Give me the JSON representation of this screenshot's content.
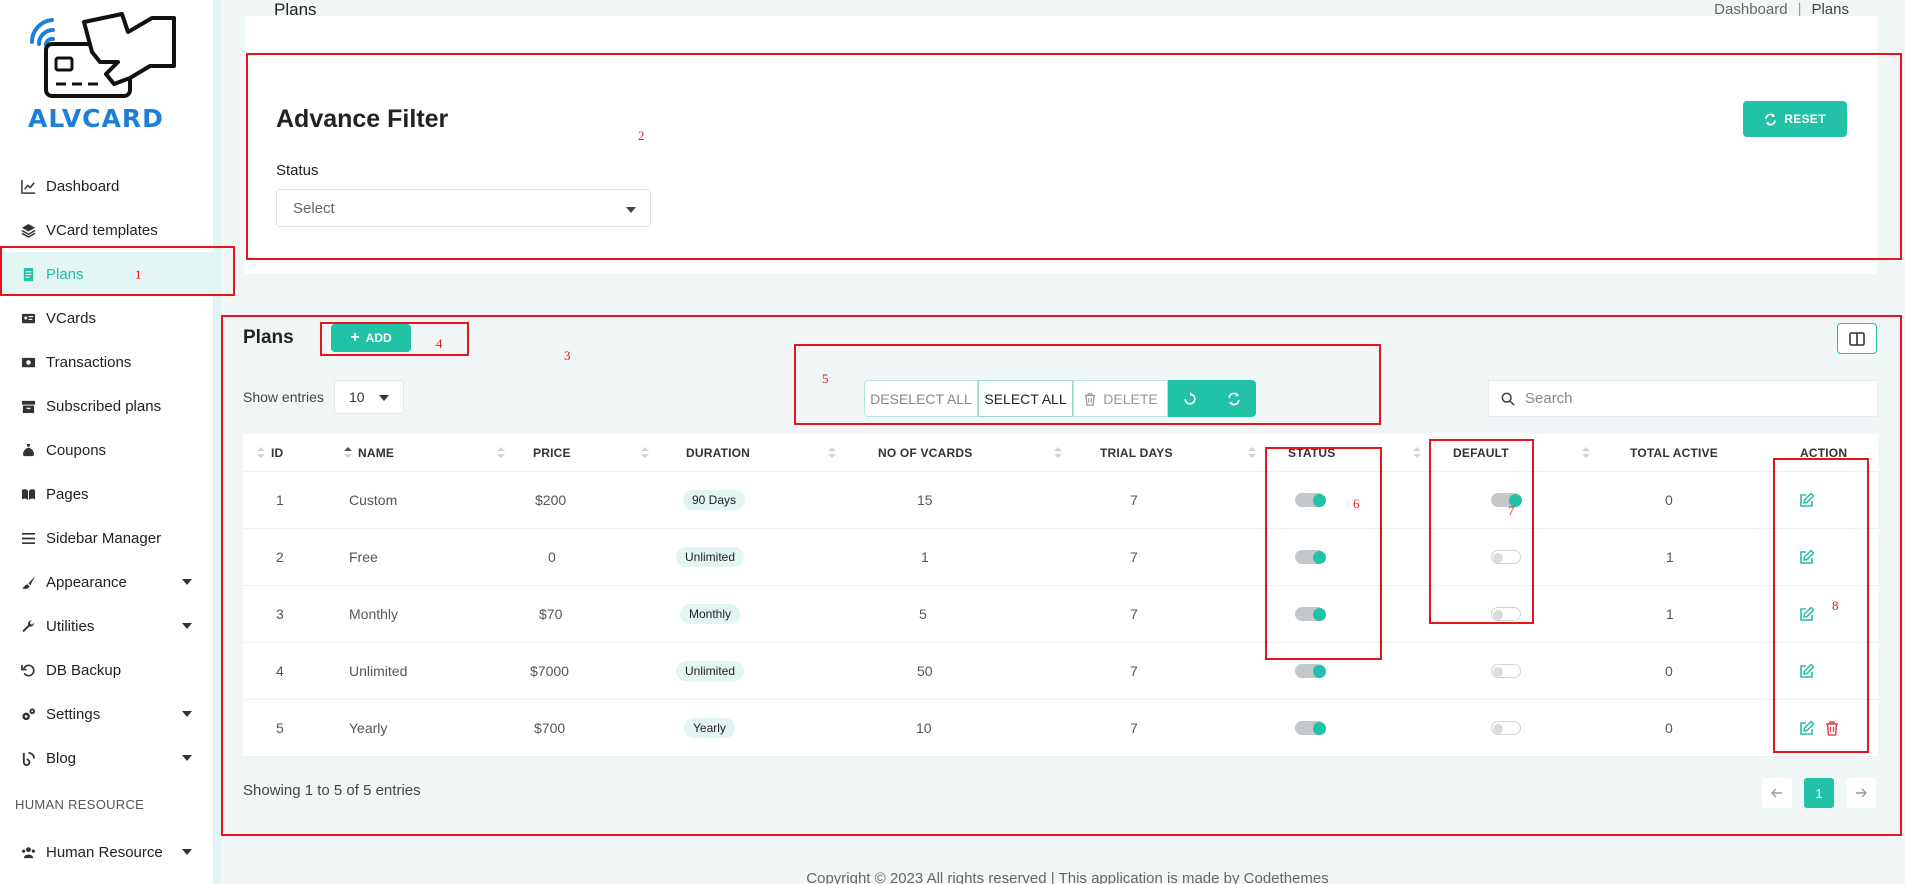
{
  "brand": {
    "name": "ALVCARD",
    "logo_icon": "card-payment-wireless-icon"
  },
  "sidebar": {
    "items": [
      {
        "label": "Dashboard",
        "icon": "chart-line-icon",
        "caret": false,
        "active": false
      },
      {
        "label": "VCard templates",
        "icon": "layers-icon",
        "caret": false,
        "active": false
      },
      {
        "label": "Plans",
        "icon": "clipboard-icon",
        "caret": false,
        "active": true
      },
      {
        "label": "VCards",
        "icon": "id-card-icon",
        "caret": false,
        "active": false
      },
      {
        "label": "Transactions",
        "icon": "money-bill-icon",
        "caret": false,
        "active": false
      },
      {
        "label": "Subscribed plans",
        "icon": "archive-icon",
        "caret": false,
        "active": false
      },
      {
        "label": "Coupons",
        "icon": "sack-icon",
        "caret": false,
        "active": false
      },
      {
        "label": "Pages",
        "icon": "book-open-icon",
        "caret": false,
        "active": false
      },
      {
        "label": "Sidebar Manager",
        "icon": "menu-icon",
        "caret": false,
        "active": false
      },
      {
        "label": "Appearance",
        "icon": "paint-brush-icon",
        "caret": true,
        "active": false
      },
      {
        "label": "Utilities",
        "icon": "wrench-icon",
        "caret": true,
        "active": false
      },
      {
        "label": "DB Backup",
        "icon": "rotate-left-icon",
        "caret": false,
        "active": false
      },
      {
        "label": "Settings",
        "icon": "gears-icon",
        "caret": true,
        "active": false
      },
      {
        "label": "Blog",
        "icon": "blog-icon",
        "caret": true,
        "active": false
      }
    ],
    "section_heading": "HUMAN RESOURCE",
    "hr_item": {
      "label": "Human Resource",
      "icon": "users-icon",
      "caret": true
    }
  },
  "header": {
    "title": "Plans",
    "breadcrumb": [
      "Dashboard",
      "Plans"
    ]
  },
  "filter": {
    "title": "Advance Filter",
    "status_label": "Status",
    "status_value": "Select",
    "reset_label": "RESET"
  },
  "plans": {
    "title": "Plans",
    "add_label": "ADD",
    "show_entries_label": "Show entries",
    "entries_value": "10",
    "bulk": {
      "deselect_all": "DESELECT ALL",
      "select_all": "SELECT ALL",
      "delete": "DELETE"
    },
    "search_placeholder": "Search",
    "columns": [
      "ID",
      "NAME",
      "PRICE",
      "DURATION",
      "NO OF VCARDS",
      "TRIAL DAYS",
      "STATUS",
      "DEFAULT",
      "TOTAL ACTIVE",
      "ACTION"
    ],
    "rows": [
      {
        "id": "1",
        "name": "Custom",
        "price": "$200",
        "duration": "90 Days",
        "vcards": "15",
        "trial_days": "7",
        "status": true,
        "default": true,
        "total_active": "0",
        "deletable": false
      },
      {
        "id": "2",
        "name": "Free",
        "price": "0",
        "duration": "Unlimited",
        "vcards": "1",
        "trial_days": "7",
        "status": true,
        "default": false,
        "total_active": "1",
        "deletable": false
      },
      {
        "id": "3",
        "name": "Monthly",
        "price": "$70",
        "duration": "Monthly",
        "vcards": "5",
        "trial_days": "7",
        "status": true,
        "default": false,
        "total_active": "1",
        "deletable": false
      },
      {
        "id": "4",
        "name": "Unlimited",
        "price": "$7000",
        "duration": "Unlimited",
        "vcards": "50",
        "trial_days": "7",
        "status": true,
        "default": false,
        "total_active": "0",
        "deletable": false
      },
      {
        "id": "5",
        "name": "Yearly",
        "price": "$700",
        "duration": "Yearly",
        "vcards": "10",
        "trial_days": "7",
        "status": true,
        "default": false,
        "total_active": "0",
        "deletable": true
      }
    ],
    "showing_text": "Showing 1 to 5 of 5 entries",
    "current_page": "1"
  },
  "footer": {
    "text": "Copyright © 2023 All rights reserved | This application is made by Codethemes"
  },
  "annotations": [
    "1",
    "2",
    "3",
    "4",
    "5",
    "6",
    "7",
    "8"
  ],
  "colors": {
    "accent": "#21c2a5",
    "annotation": "#e5161b",
    "brand_blue": "#1e7fd8"
  }
}
